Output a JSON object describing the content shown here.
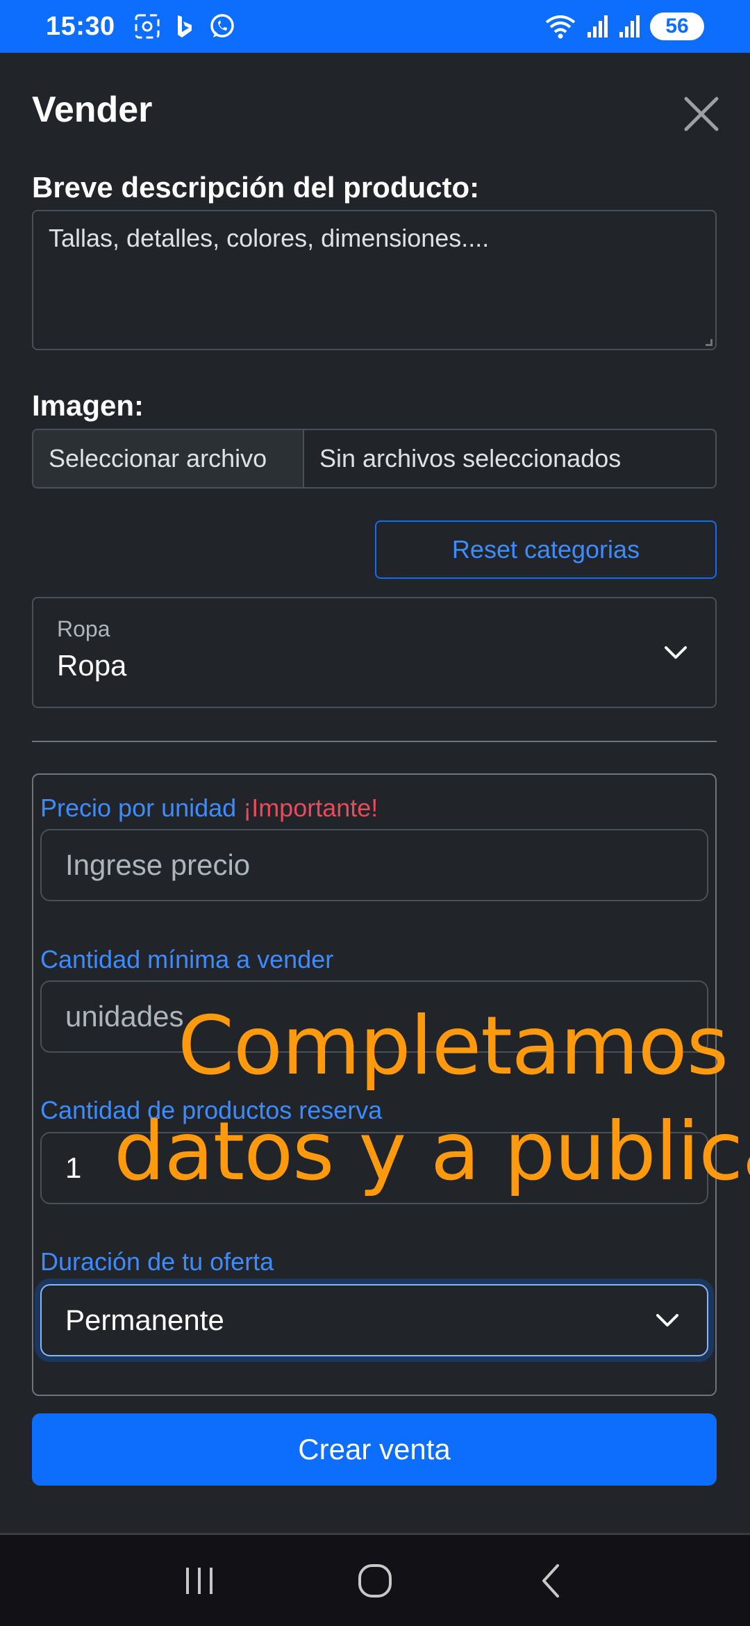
{
  "status_bar": {
    "time": "15:30",
    "battery_level": "56",
    "icons": [
      "screenshot-icon",
      "bing-icon",
      "whatsapp-icon",
      "wifi-icon",
      "signal-icon",
      "signal-icon-2"
    ]
  },
  "modal": {
    "title": "Vender",
    "description_label": "Breve descripción del producto:",
    "description_placeholder": "Tallas, detalles, colores, dimensiones....",
    "image_label": "Imagen:",
    "file_button_label": "Seleccionar archivo",
    "file_status": "Sin archivos seleccionados",
    "reset_button_label": "Reset categorias",
    "category_select": {
      "label": "Ropa",
      "value": "Ropa"
    }
  },
  "fields": {
    "price_label": "Precio por unidad",
    "price_important": "¡Importante!",
    "price_placeholder": "Ingrese precio",
    "min_qty_label": "Cantidad mínima a vender",
    "min_qty_placeholder": "unidades",
    "reserve_label": "Cantidad de productos reserva",
    "reserve_value": "1",
    "duration_label": "Duración de tu oferta",
    "duration_value": "Permanente"
  },
  "create_button_label": "Crear venta",
  "overlay": {
    "line1": "Completamos",
    "line2": "datos y a publicar"
  },
  "colors": {
    "primary": "#0d6efd",
    "background": "#212529",
    "danger": "#ea4a5a",
    "overlay_text": "#ff9a0e"
  }
}
